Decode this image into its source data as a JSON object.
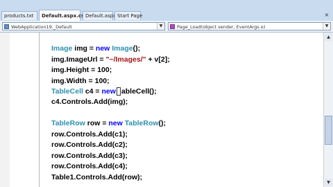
{
  "tabs": [
    {
      "label": "products.txt",
      "active": false
    },
    {
      "label": "Default.aspx.cs*",
      "active": true
    },
    {
      "label": "Default.aspx",
      "active": false
    },
    {
      "label": "Start Page",
      "active": false
    }
  ],
  "tab_close": "×",
  "navbar": {
    "class_selector": "WebApplication19._Default",
    "member_selector": "Page_Load(object sender, EventArgs e)"
  },
  "code": {
    "line1": {
      "type": "Image",
      "a": " img = ",
      "kw": "new",
      "b": " ",
      "type2": "Image",
      "c": "();"
    },
    "line2": {
      "a": "img.ImageUrl = ",
      "str": "\"~/Images/\"",
      "b": " + v[2];"
    },
    "line3": "img.Height = 100;",
    "line4": "img.Width = 100;",
    "line5": {
      "type": "TableCell",
      "a": " c4 = ",
      "kw": "new",
      "b": "ableCell();"
    },
    "line6": "c4.Controls.Add(img);",
    "line7": {
      "type": "TableRow",
      "a": " row = ",
      "kw": "new",
      "b": " ",
      "type2": "TableRow",
      "c": "();"
    },
    "line8": "row.Controls.Add(c1);",
    "line9": "row.Controls.Add(c2);",
    "line10": "row.Controls.Add(c3);",
    "line11": "row.Controls.Add(c4);",
    "line12": "Table1.Controls.Add(row);"
  },
  "colors": {
    "keyword": "#0000ff",
    "type": "#2b91af",
    "string": "#a31515"
  },
  "icons": {
    "scroll_up": "▲",
    "scroll_down": "▼",
    "dropdown": "▼"
  }
}
